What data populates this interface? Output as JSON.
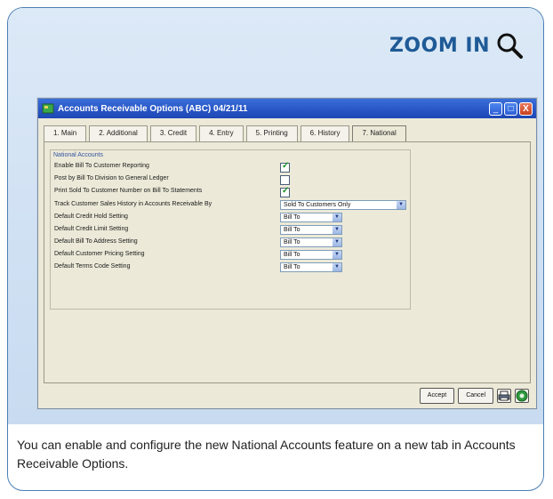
{
  "callout": {
    "zoom_label": "ZOOM IN",
    "icon": "magnifier-icon"
  },
  "window": {
    "title": "Accounts Receivable Options (ABC) 04/21/11",
    "controls": {
      "minimize": "_",
      "maximize": "□",
      "close": "X"
    }
  },
  "tabs": [
    {
      "label": "1. Main"
    },
    {
      "label": "2. Additional"
    },
    {
      "label": "3. Credit"
    },
    {
      "label": "4. Entry"
    },
    {
      "label": "5. Printing"
    },
    {
      "label": "6. History"
    },
    {
      "label": "7. National",
      "active": true
    }
  ],
  "group": {
    "label": "National Accounts",
    "rows": [
      {
        "label": "Enable Bill To Customer Reporting",
        "checked": true
      },
      {
        "label": "Post by Bill To Division to General Ledger",
        "checked": false
      },
      {
        "label": "Print Sold To Customer Number on Bill To Statements",
        "checked": true
      },
      {
        "label": "Track Customer Sales History in Accounts Receivable By",
        "value": "Sold To Customers Only"
      },
      {
        "label": "Default Credit Hold Setting",
        "value": "Bill To"
      },
      {
        "label": "Default Credit Limit Setting",
        "value": "Bill To"
      },
      {
        "label": "Default Bill To Address Setting",
        "value": "Bill To"
      },
      {
        "label": "Default Customer Pricing Setting",
        "value": "Bill To"
      },
      {
        "label": "Default Terms Code Setting",
        "value": "Bill To"
      }
    ]
  },
  "buttons": {
    "accept": "Accept",
    "cancel": "Cancel",
    "print_icon": "printer-icon",
    "help_icon": "help-icon"
  },
  "caption": "You can enable and configure the new National Accounts feature on a new tab in Accounts Receivable Options.",
  "colors": {
    "accent": "#1f5a96",
    "titlebar": "#2a58c8",
    "check": "#1d8f2a"
  }
}
